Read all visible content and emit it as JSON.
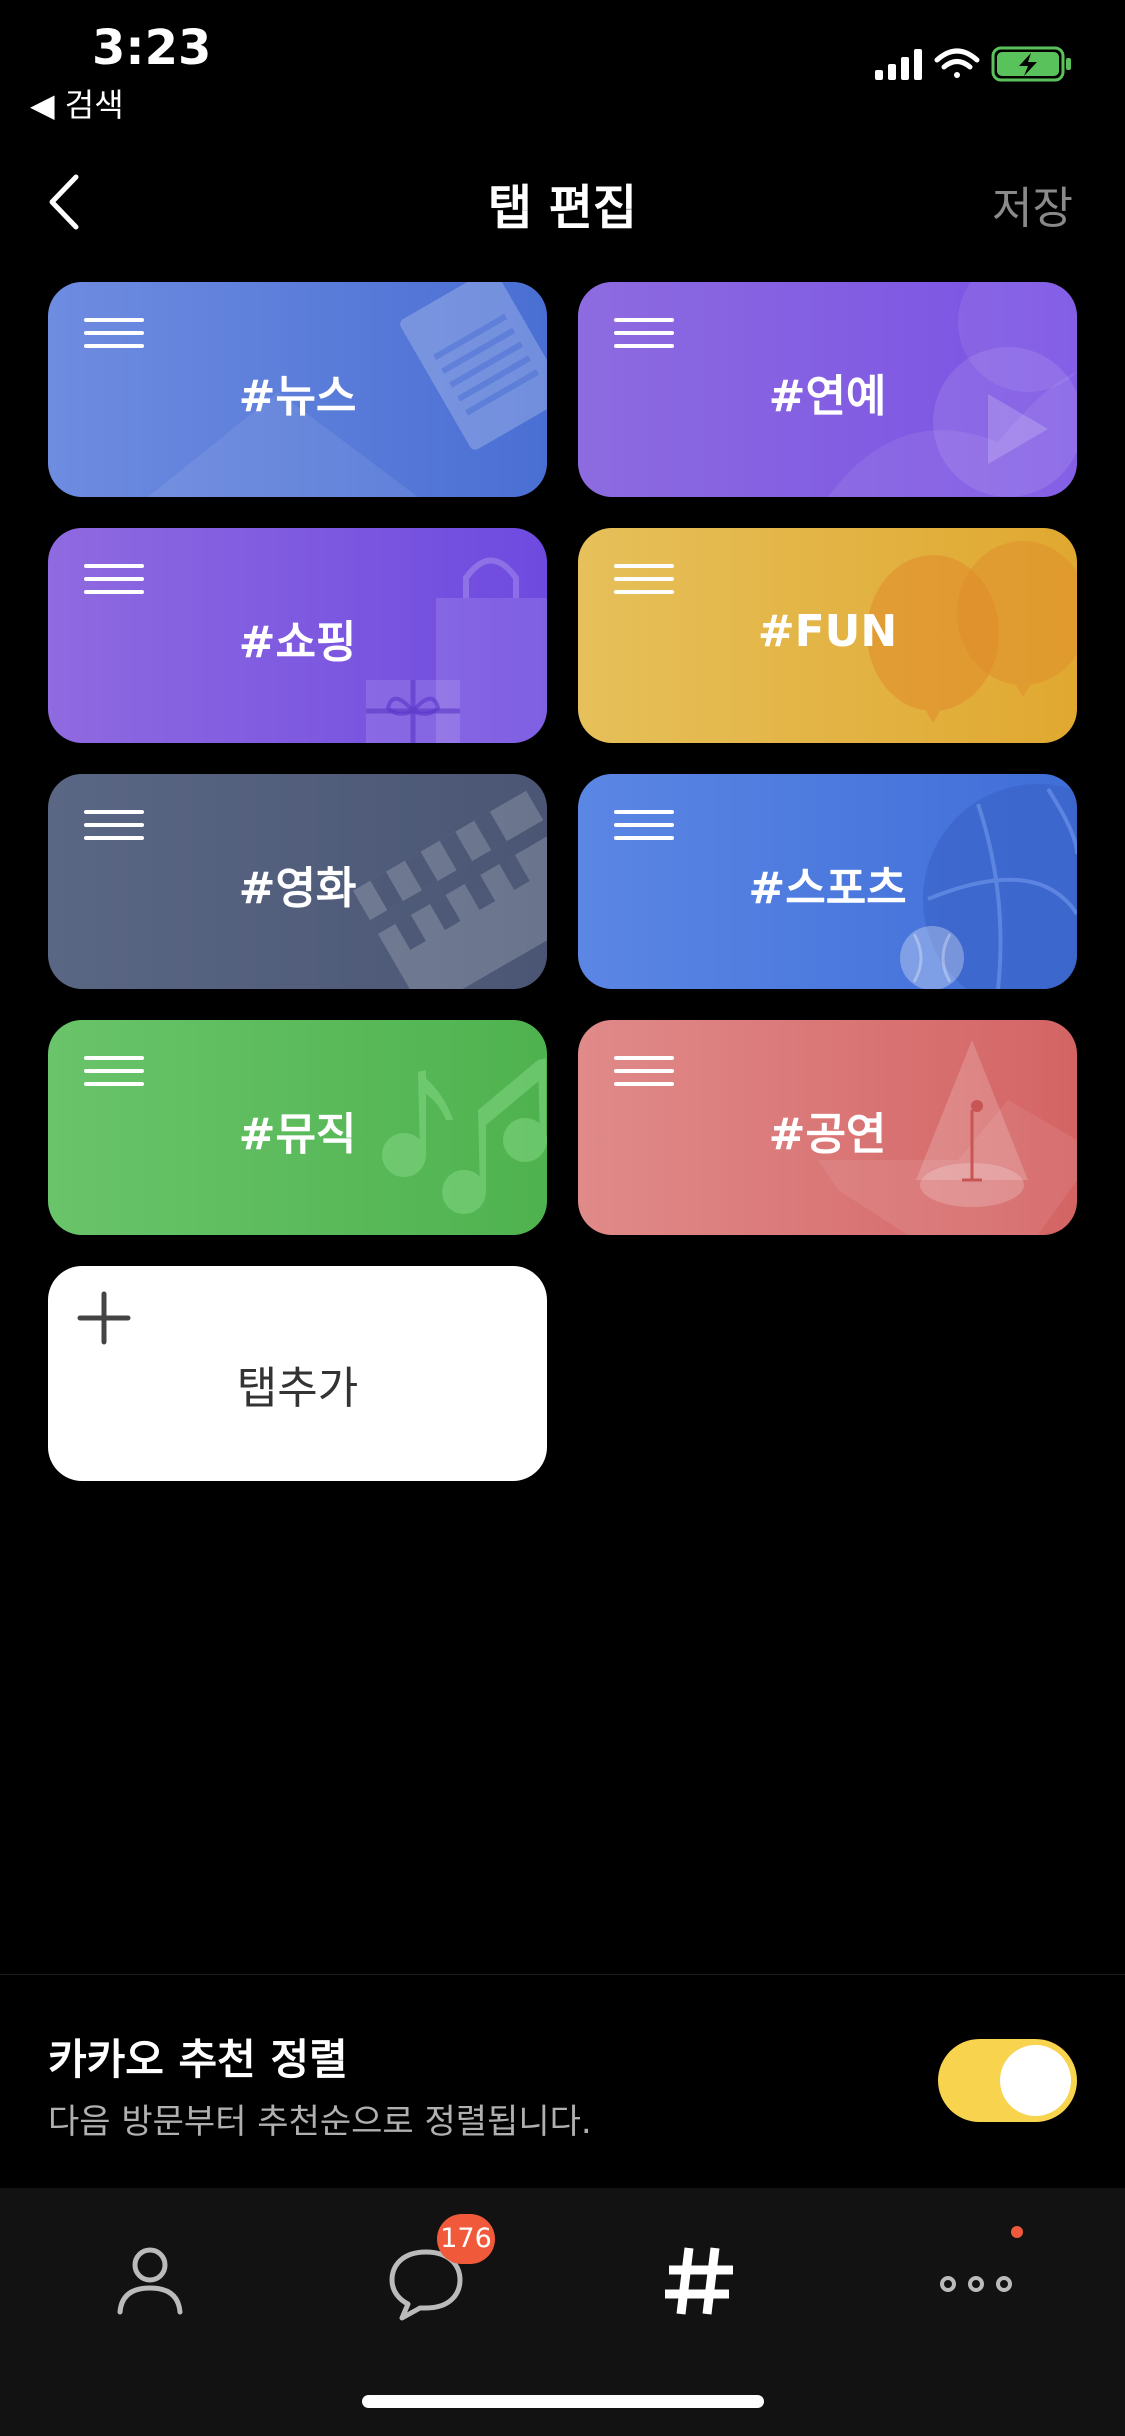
{
  "status_bar": {
    "time": "3:23",
    "back_label": "◀ 검색",
    "icons": [
      "signal-icon",
      "wifi-icon",
      "battery-charging-icon"
    ]
  },
  "header": {
    "title": "탭 편집",
    "save_label": "저장",
    "back_icon": "chevron-left-icon"
  },
  "tabs": [
    {
      "label": "#뉴스"
    },
    {
      "label": "#연예"
    },
    {
      "label": "#쇼핑"
    },
    {
      "label": "#FUN"
    },
    {
      "label": "#영화"
    },
    {
      "label": "#스포츠"
    },
    {
      "label": "#뮤직"
    },
    {
      "label": "#공연"
    }
  ],
  "add_tab": {
    "label": "탭추가",
    "icon": "plus-icon"
  },
  "sort": {
    "title": "카카오 추천 정렬",
    "description": "다음 방문부터 추천순으로 정렬됩니다.",
    "enabled": true,
    "toggle_color": "#f7d34e"
  },
  "tab_bar": {
    "items": [
      "person-icon",
      "chat-bubble-icon",
      "hashtag-icon",
      "more-icon"
    ],
    "chat_badge": "176",
    "badge_color": "#f05a3a"
  }
}
